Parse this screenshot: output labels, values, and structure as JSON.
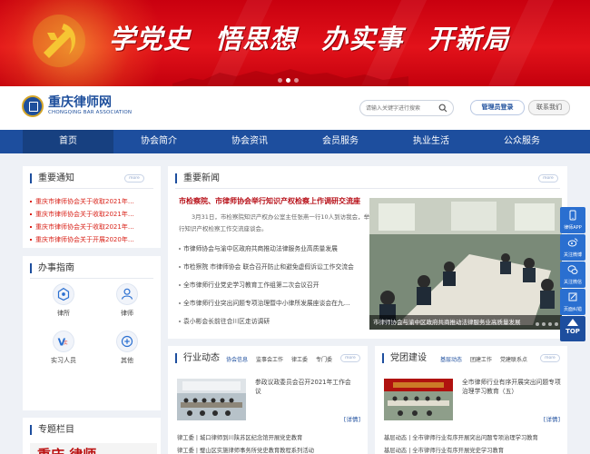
{
  "banner": {
    "slogan": [
      "学党史",
      "悟思想",
      "办实事",
      "开新局"
    ],
    "active_slide": 2,
    "slides": 3
  },
  "header": {
    "logo_cn": "重庆律师网",
    "logo_en": "CHONGQING BAR ASSOCIATION",
    "search_placeholder": "请输入关键字进行搜索",
    "admin_login": "管理员登录",
    "contact": "联系我们"
  },
  "nav": {
    "items": [
      "首页",
      "协会简介",
      "协会资讯",
      "会员服务",
      "执业生活",
      "公众服务"
    ],
    "active": 0
  },
  "notice": {
    "title": "重要通知",
    "more": "more",
    "items": [
      "重庆市律师协会关于收取2021年…",
      "重庆市律师协会关于收取2021年…",
      "重庆市律师协会关于收取2021年…",
      "重庆市律师协会关于开展2020年…"
    ]
  },
  "guide": {
    "title": "办事指南",
    "items": [
      {
        "label": "律所",
        "icon": "law-firm-icon"
      },
      {
        "label": "律师",
        "icon": "lawyer-icon"
      },
      {
        "label": "实习人员",
        "icon": "trainee-icon"
      },
      {
        "label": "其他",
        "icon": "other-icon"
      }
    ]
  },
  "special": {
    "title": "专题栏目",
    "image_text": "重庆 律师"
  },
  "news": {
    "title": "重要新闻",
    "more": "more",
    "headline": "市检察院、市律师协会举行知识产权检察上作调研交流座",
    "summary": "3月31日，市检察院知识产权办公室主任张燕一行10人到访我会，举行知识产权检察工作交流座谈会。",
    "items": [
      "市律师协会与渝中区政府共商推动法律服务业高质量发展",
      "市检察院 市律师协会 联合召开防止和避免虚假诉讼工作交流会",
      "全市律师行业党史学习教育工作组第二次会议召开",
      "全市律师行业突出问题专项治理暨中小律所发展座谈会在九…",
      "袁小彬会长前往合川区走访调研"
    ],
    "photo_caption": "市律师协会与渝中区政府共商推动法律服务业高质量发展"
  },
  "industry": {
    "title": "行业动态",
    "tabs": [
      "协会信息",
      "监事会工作",
      "律工委",
      "专门委"
    ],
    "more": "more",
    "feature_title": "参政议政委员会召开2021年工作会议",
    "detail": "[详情]",
    "rows": [
      "律工委 | 城口律师到川陕苏区纪念馆开展党史教育",
      "律工委 | 璧山区实施律师事务所党史教育教程系列活动"
    ]
  },
  "party": {
    "title": "党团建设",
    "tabs": [
      "基层动态",
      "团建工作",
      "党建联系点"
    ],
    "more": "more",
    "feature_title": "全市律师行业有序开展突出问题专项治理学习教育（五）",
    "detail": "[详情]",
    "rows": [
      "基层动态 | 全市律师行业有序开展突出问题专项治理学习教育",
      "基层动态 | 全市律师行业有序开展党史学习教育"
    ]
  },
  "float_bar": {
    "items": [
      "律师APP",
      "关注微博",
      "关注微信",
      "页面纠错"
    ],
    "top": "TOP"
  },
  "colors": {
    "brand_blue": "#1d4e9e",
    "banner_red": "#e2121a",
    "notice_red": "#d9241b"
  }
}
